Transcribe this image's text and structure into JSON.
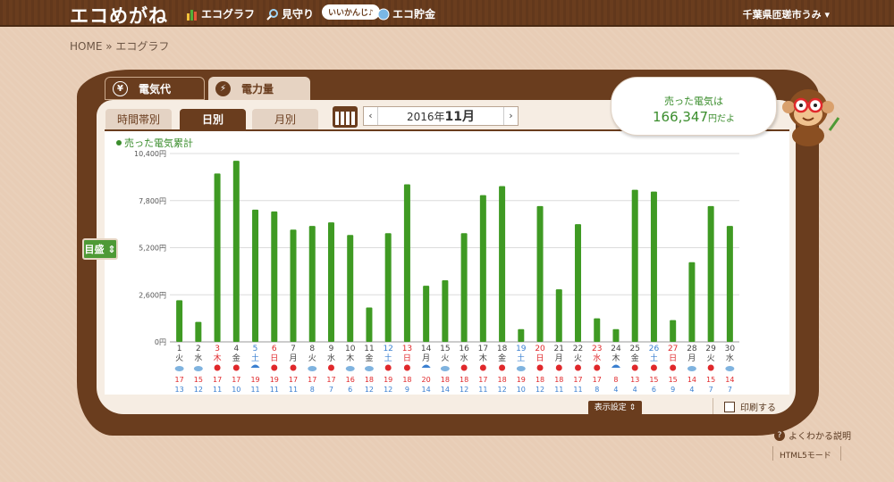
{
  "header": {
    "logo": "エコめがね",
    "nav": [
      {
        "label": "エコグラフ",
        "icon": "bar-chart-icon"
      },
      {
        "label": "見守り",
        "icon": "magnifier-icon"
      },
      {
        "label": "エコ貯金",
        "icon": "coin-icon"
      }
    ],
    "bubble": "いいかんじ♪",
    "user": "千葉県匝瑳市うみ ▾"
  },
  "breadcrumb": "HOME » エコグラフ",
  "tabs": {
    "main": [
      {
        "label": "電気代",
        "icon": "yen-icon"
      },
      {
        "label": "電力量",
        "icon": "lightning-icon"
      }
    ],
    "sub": [
      "時間帯別",
      "日別",
      "月別"
    ]
  },
  "month_nav": {
    "year": "2016年",
    "month": "11月",
    "prev": "‹",
    "next": "›"
  },
  "sold": {
    "label": "売った電気は",
    "value": "166,347",
    "unit": "円だよ"
  },
  "scale_button": "目盛 ⇕",
  "footer": {
    "settings": "表示設定 ⇕",
    "print": "印刷する",
    "help": "よくわかる説明",
    "html5": "HTML5モード"
  },
  "colors": {
    "bar": "#3f9a23",
    "brown": "#6a3d1e",
    "red": "#e0282b",
    "blue": "#3a7fd0"
  },
  "chart_data": {
    "type": "bar",
    "legend": "売った電気累計",
    "ylim": [
      0,
      10400
    ],
    "yticks": [
      "0円",
      "2,600円",
      "5,200円",
      "7,800円",
      "10,400円"
    ],
    "days": [
      "1",
      "2",
      "3",
      "4",
      "5",
      "6",
      "7",
      "8",
      "9",
      "10",
      "11",
      "12",
      "13",
      "14",
      "15",
      "16",
      "17",
      "18",
      "19",
      "20",
      "21",
      "22",
      "23",
      "24",
      "25",
      "26",
      "27",
      "28",
      "29",
      "30"
    ],
    "weekdays": [
      "火",
      "水",
      "木",
      "金",
      "土",
      "日",
      "月",
      "火",
      "水",
      "木",
      "金",
      "土",
      "日",
      "月",
      "火",
      "水",
      "木",
      "金",
      "土",
      "日",
      "月",
      "火",
      "水",
      "木",
      "金",
      "土",
      "日",
      "月",
      "火",
      "水"
    ],
    "day_colors": [
      "n",
      "n",
      "r",
      "n",
      "b",
      "r",
      "n",
      "n",
      "n",
      "n",
      "n",
      "b",
      "r",
      "n",
      "n",
      "n",
      "n",
      "n",
      "b",
      "r",
      "n",
      "n",
      "r",
      "n",
      "n",
      "b",
      "r",
      "n",
      "n",
      "n"
    ],
    "values": [
      2300,
      1100,
      9300,
      10000,
      7300,
      7200,
      6200,
      6400,
      6600,
      5900,
      1900,
      6000,
      8700,
      3100,
      3400,
      6000,
      8100,
      8600,
      700,
      7500,
      2900,
      6500,
      1300,
      700,
      8400,
      8300,
      1200,
      4400,
      7500,
      6400
    ],
    "weather": [
      "sun-cloud",
      "sun-cloud",
      "sun",
      "sun",
      "umbrella",
      "sun",
      "sun",
      "sun-cloud",
      "sun",
      "sun-cloud",
      "sun-cloud",
      "sun",
      "sun",
      "umbrella",
      "sun-cloud",
      "sun",
      "sun",
      "sun",
      "sun-cloud",
      "sun",
      "sun",
      "sun",
      "sun",
      "umbrella",
      "sun",
      "sun",
      "sun",
      "sun-cloud",
      "sun",
      "sun-cloud"
    ],
    "temp_high": [
      "17",
      "15",
      "17",
      "17",
      "19",
      "19",
      "17",
      "17",
      "17",
      "16",
      "18",
      "19",
      "18",
      "20",
      "18",
      "18",
      "17",
      "18",
      "19",
      "18",
      "18",
      "17",
      "17",
      "8",
      "13",
      "15",
      "15",
      "14",
      "15",
      "14"
    ],
    "temp_low": [
      "13",
      "12",
      "11",
      "10",
      "11",
      "11",
      "11",
      "8",
      "7",
      "6",
      "12",
      "12",
      "9",
      "14",
      "14",
      "12",
      "11",
      "12",
      "10",
      "12",
      "11",
      "11",
      "8",
      "4",
      "4",
      "6",
      "9",
      "4",
      "7",
      "7"
    ]
  }
}
